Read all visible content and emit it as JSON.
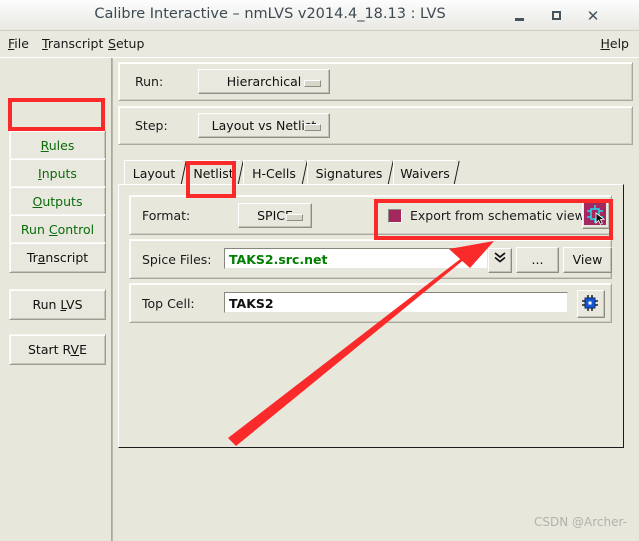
{
  "window": {
    "title": "Calibre Interactive – nmLVS v2014.4_18.13 : LVS",
    "controls": {
      "minimize": "–",
      "maximize": "□",
      "close": "✕"
    }
  },
  "menubar": {
    "items": [
      {
        "label": "File",
        "mnemonic": "F"
      },
      {
        "label": "Transcript",
        "mnemonic": "T"
      },
      {
        "label": "Setup",
        "mnemonic": "S"
      }
    ],
    "help": {
      "label": "Help",
      "mnemonic": "H"
    }
  },
  "sidebar": {
    "items": [
      {
        "label": "Rules",
        "color": "#0a6b0a"
      },
      {
        "label": "Inputs",
        "color": "#0a6b0a",
        "selected": true
      },
      {
        "label": "Outputs",
        "color": "#0a6b0a"
      },
      {
        "label": "Run Control",
        "color": "#0a6b0a"
      },
      {
        "label": "Transcript",
        "color": "#111111"
      },
      {
        "label": "Run LVS",
        "color": "#111111"
      },
      {
        "label": "Start RVE",
        "color": "#111111"
      }
    ]
  },
  "main": {
    "run": {
      "label": "Run:",
      "value": "Hierarchical"
    },
    "step": {
      "label": "Step:",
      "value": "Layout vs Netlist"
    },
    "tabs": [
      {
        "label": "Layout"
      },
      {
        "label": "Netlist",
        "selected": true
      },
      {
        "label": "H-Cells"
      },
      {
        "label": "Signatures"
      },
      {
        "label": "Waivers"
      }
    ],
    "netlist_panel": {
      "format": {
        "label": "Format:",
        "value": "SPICE"
      },
      "export_schematic": {
        "checkbox_color": "#a4275f",
        "label": "Export from schematic viewer",
        "icon": "schematic-export-icon"
      },
      "spice_files": {
        "label": "Spice Files:",
        "value": "TAKS2.src.net",
        "value_color": "#008000",
        "dropdown": "⌄",
        "browse_button": "...",
        "view_button": "View"
      },
      "top_cell": {
        "label": "Top Cell:",
        "value": "TAKS2",
        "value_color": "#111111",
        "icon": "chip-cell-icon"
      }
    }
  },
  "annotations": {
    "accent_color": "#fb2a2a",
    "highlight_inputs": true,
    "highlight_netlist_tab": true,
    "highlight_export_row": true,
    "arrow": "points to export-from-schematic-viewer row"
  },
  "watermark": {
    "text": "CSDN @Archer-"
  }
}
